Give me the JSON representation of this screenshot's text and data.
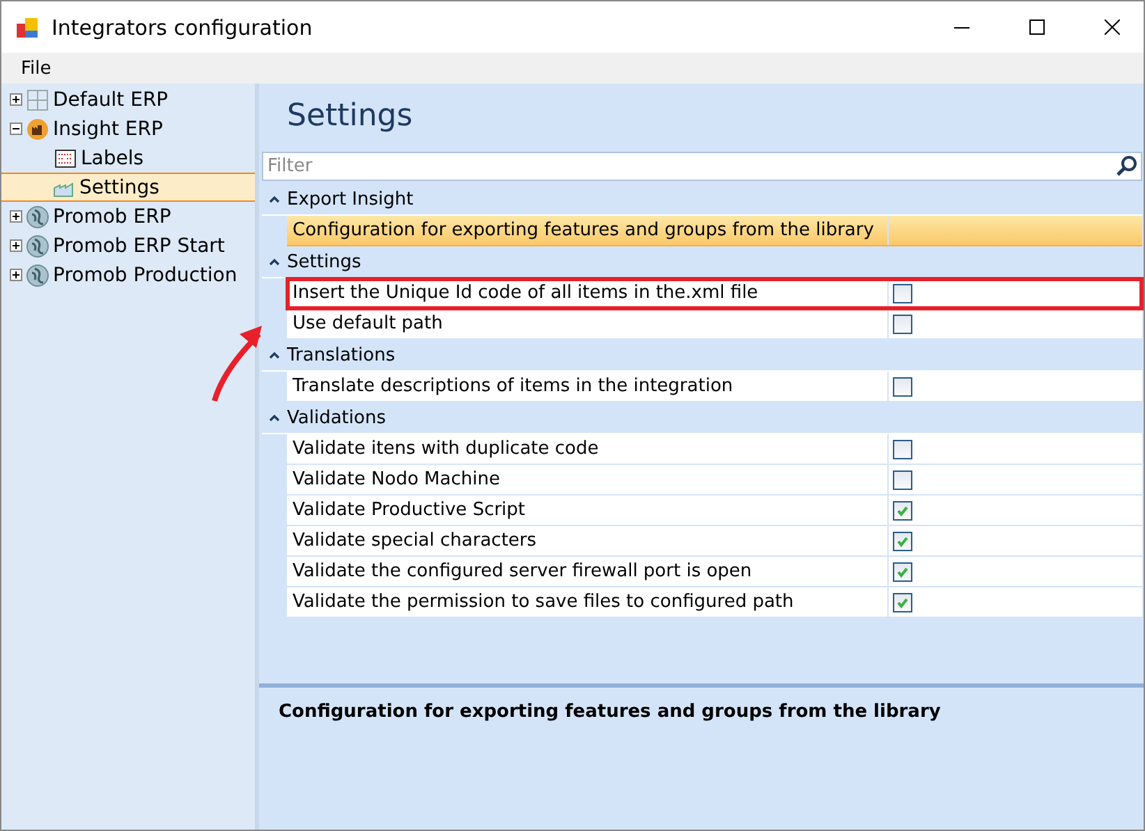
{
  "window": {
    "title": "Integrators configuration"
  },
  "menu": [
    "File"
  ],
  "tree": [
    {
      "label": "Default ERP",
      "kind": "grid",
      "expanded": false,
      "selected": false
    },
    {
      "label": "Insight ERP",
      "kind": "factory",
      "expanded": true,
      "selected": false,
      "children": [
        {
          "label": "Labels",
          "kind": "labels",
          "selected": false
        },
        {
          "label": "Settings",
          "kind": "chart",
          "selected": true
        }
      ]
    },
    {
      "label": "Promob ERP",
      "kind": "globe",
      "expanded": false,
      "selected": false
    },
    {
      "label": "Promob ERP Start",
      "kind": "globe",
      "expanded": false,
      "selected": false
    },
    {
      "label": "Promob Production",
      "kind": "globe",
      "expanded": false,
      "selected": false
    }
  ],
  "page_title": "Settings",
  "filter": {
    "placeholder": "Filter"
  },
  "categories": [
    {
      "label": "Export Insight",
      "expanded": true,
      "items": [
        {
          "label": "Configuration for exporting features and groups from the library",
          "kind": "text",
          "selected": true,
          "annotated": false
        }
      ]
    },
    {
      "label": "Settings",
      "expanded": true,
      "items": [
        {
          "label": "Insert the Unique Id code of all items in the.xml file",
          "kind": "checkbox",
          "checked": false,
          "selected": false,
          "annotated": true
        },
        {
          "label": "Use default path",
          "kind": "checkbox",
          "checked": false,
          "selected": false,
          "annotated": false
        }
      ]
    },
    {
      "label": "Translations",
      "expanded": true,
      "items": [
        {
          "label": "Translate descriptions of items in the integration",
          "kind": "checkbox",
          "checked": false,
          "selected": false,
          "annotated": false
        }
      ]
    },
    {
      "label": "Validations",
      "expanded": true,
      "items": [
        {
          "label": "Validate itens with duplicate code",
          "kind": "checkbox",
          "checked": false,
          "selected": false,
          "annotated": false
        },
        {
          "label": "Validate Nodo Machine",
          "kind": "checkbox",
          "checked": false,
          "selected": false,
          "annotated": false
        },
        {
          "label": "Validate Productive Script",
          "kind": "checkbox",
          "checked": true,
          "selected": false,
          "annotated": false
        },
        {
          "label": "Validate special characters",
          "kind": "checkbox",
          "checked": true,
          "selected": false,
          "annotated": false
        },
        {
          "label": "Validate the configured server firewall port is open",
          "kind": "checkbox",
          "checked": true,
          "selected": false,
          "annotated": false
        },
        {
          "label": "Validate the permission to save files to configured path",
          "kind": "checkbox",
          "checked": true,
          "selected": false,
          "annotated": false
        }
      ]
    }
  ],
  "description": "Configuration for exporting features and groups from the library"
}
